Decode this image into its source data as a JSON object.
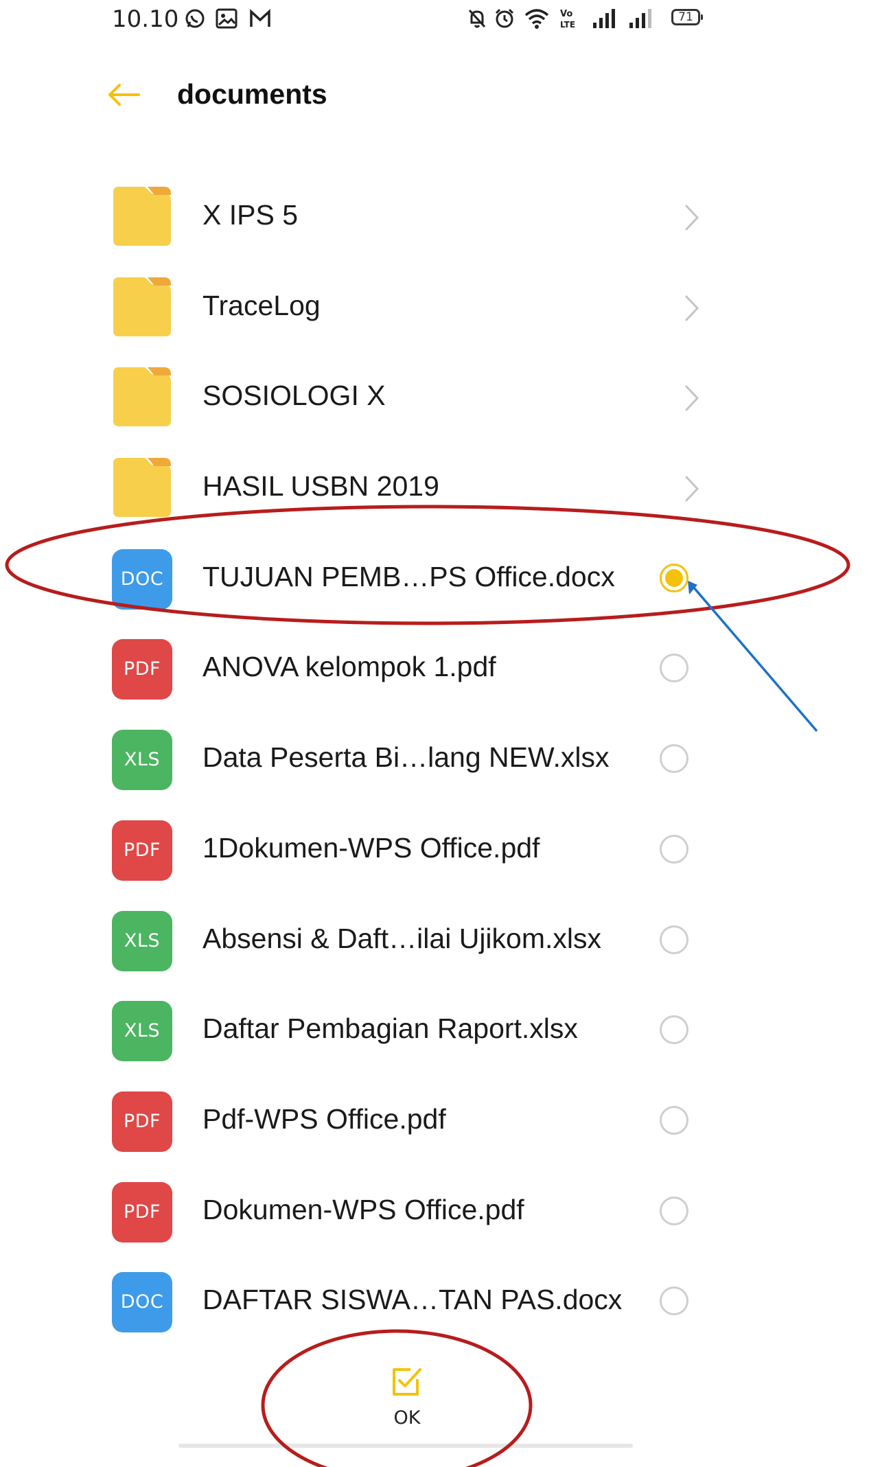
{
  "status_bar": {
    "time": "10.10",
    "battery": "71",
    "icons": [
      "whatsapp-icon",
      "gallery-icon",
      "gmail-icon",
      "mute-icon",
      "alarm-icon",
      "wifi-icon",
      "volte-icon",
      "signal-icon",
      "signal-icon-2",
      "battery-icon"
    ]
  },
  "header": {
    "back_icon": "arrow-left-icon",
    "title": "documents"
  },
  "files": [
    {
      "kind": "folder",
      "name": "X IPS 5"
    },
    {
      "kind": "folder",
      "name": "TraceLog"
    },
    {
      "kind": "folder",
      "name": "SOSIOLOGI X"
    },
    {
      "kind": "folder",
      "name": "HASIL USBN 2019"
    },
    {
      "kind": "file",
      "type_label": "DOC",
      "name": "TUJUAN PEMB…PS Office.docx",
      "selected": true
    },
    {
      "kind": "file",
      "type_label": "PDF",
      "name": "ANOVA kelompok 1.pdf",
      "selected": false
    },
    {
      "kind": "file",
      "type_label": "XLS",
      "name": "Data Peserta Bi…lang NEW.xlsx",
      "selected": false
    },
    {
      "kind": "file",
      "type_label": "PDF",
      "name": "1Dokumen-WPS Office.pdf",
      "selected": false
    },
    {
      "kind": "file",
      "type_label": "XLS",
      "name": "Absensi & Daft…ilai Ujikom.xlsx",
      "selected": false
    },
    {
      "kind": "file",
      "type_label": "XLS",
      "name": "Daftar Pembagian Raport.xlsx",
      "selected": false
    },
    {
      "kind": "file",
      "type_label": "PDF",
      "name": "Pdf-WPS Office.pdf",
      "selected": false
    },
    {
      "kind": "file",
      "type_label": "PDF",
      "name": "Dokumen-WPS Office.pdf",
      "selected": false
    },
    {
      "kind": "file",
      "type_label": "DOC",
      "name": "DAFTAR SISWA…TAN PAS.docx",
      "selected": false
    }
  ],
  "action": {
    "ok_label": "OK",
    "ok_icon": "checkbox-icon"
  },
  "colors": {
    "accent": "#f4c20d",
    "folder": "#f7cf4a",
    "doc": "#3d9be9",
    "pdf": "#e04747",
    "xls": "#4cb561",
    "annotation_ellipse": "#b81c1c",
    "annotation_arrow": "#1f72c4"
  }
}
